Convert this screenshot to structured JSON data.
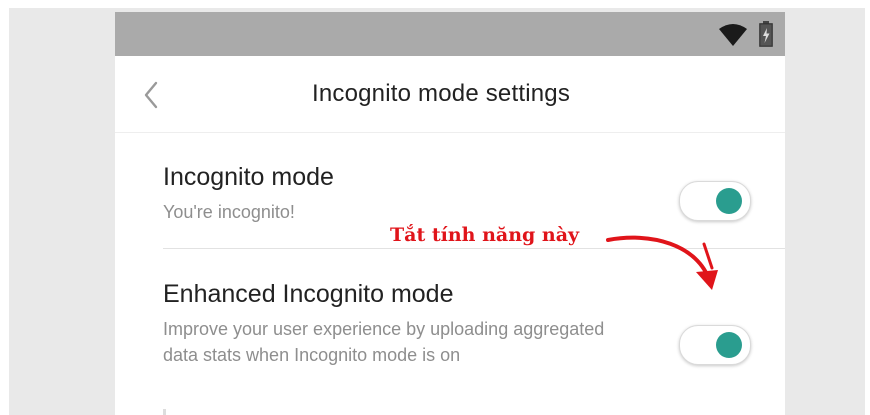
{
  "status_bar": {
    "icons": [
      "wifi-icon",
      "battery-charging-icon"
    ]
  },
  "header": {
    "title": "Incognito mode settings",
    "back_icon": "chevron-left-icon"
  },
  "settings": [
    {
      "title": "Incognito mode",
      "description": "You're incognito!",
      "toggle_on": true
    },
    {
      "title": "Enhanced Incognito mode",
      "description": "Improve your user experience by uploading aggregated data stats when Incognito mode is on",
      "toggle_on": true
    }
  ],
  "annotation": {
    "text": "Tắt tính năng này",
    "color": "#e0141a"
  },
  "colors": {
    "status_bar": "#aaaaaa",
    "toggle_accent": "#2a9d8f",
    "page_background": "#e9e9e9"
  }
}
